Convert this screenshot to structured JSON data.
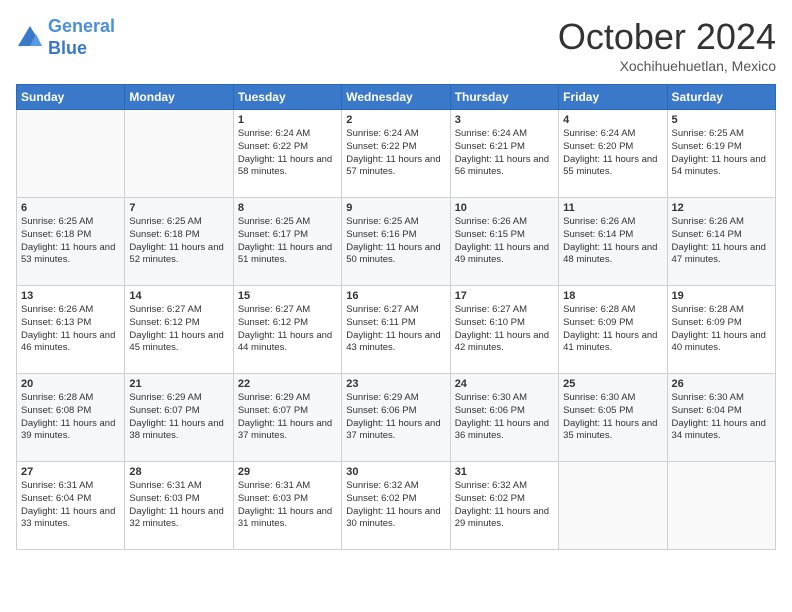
{
  "header": {
    "logo_line1": "General",
    "logo_line2": "Blue",
    "month": "October 2024",
    "location": "Xochihuehuetlan, Mexico"
  },
  "weekdays": [
    "Sunday",
    "Monday",
    "Tuesday",
    "Wednesday",
    "Thursday",
    "Friday",
    "Saturday"
  ],
  "weeks": [
    [
      {
        "day": "",
        "content": ""
      },
      {
        "day": "",
        "content": ""
      },
      {
        "day": "1",
        "content": "Sunrise: 6:24 AM\nSunset: 6:22 PM\nDaylight: 11 hours and 58 minutes."
      },
      {
        "day": "2",
        "content": "Sunrise: 6:24 AM\nSunset: 6:22 PM\nDaylight: 11 hours and 57 minutes."
      },
      {
        "day": "3",
        "content": "Sunrise: 6:24 AM\nSunset: 6:21 PM\nDaylight: 11 hours and 56 minutes."
      },
      {
        "day": "4",
        "content": "Sunrise: 6:24 AM\nSunset: 6:20 PM\nDaylight: 11 hours and 55 minutes."
      },
      {
        "day": "5",
        "content": "Sunrise: 6:25 AM\nSunset: 6:19 PM\nDaylight: 11 hours and 54 minutes."
      }
    ],
    [
      {
        "day": "6",
        "content": "Sunrise: 6:25 AM\nSunset: 6:18 PM\nDaylight: 11 hours and 53 minutes."
      },
      {
        "day": "7",
        "content": "Sunrise: 6:25 AM\nSunset: 6:18 PM\nDaylight: 11 hours and 52 minutes."
      },
      {
        "day": "8",
        "content": "Sunrise: 6:25 AM\nSunset: 6:17 PM\nDaylight: 11 hours and 51 minutes."
      },
      {
        "day": "9",
        "content": "Sunrise: 6:25 AM\nSunset: 6:16 PM\nDaylight: 11 hours and 50 minutes."
      },
      {
        "day": "10",
        "content": "Sunrise: 6:26 AM\nSunset: 6:15 PM\nDaylight: 11 hours and 49 minutes."
      },
      {
        "day": "11",
        "content": "Sunrise: 6:26 AM\nSunset: 6:14 PM\nDaylight: 11 hours and 48 minutes."
      },
      {
        "day": "12",
        "content": "Sunrise: 6:26 AM\nSunset: 6:14 PM\nDaylight: 11 hours and 47 minutes."
      }
    ],
    [
      {
        "day": "13",
        "content": "Sunrise: 6:26 AM\nSunset: 6:13 PM\nDaylight: 11 hours and 46 minutes."
      },
      {
        "day": "14",
        "content": "Sunrise: 6:27 AM\nSunset: 6:12 PM\nDaylight: 11 hours and 45 minutes."
      },
      {
        "day": "15",
        "content": "Sunrise: 6:27 AM\nSunset: 6:12 PM\nDaylight: 11 hours and 44 minutes."
      },
      {
        "day": "16",
        "content": "Sunrise: 6:27 AM\nSunset: 6:11 PM\nDaylight: 11 hours and 43 minutes."
      },
      {
        "day": "17",
        "content": "Sunrise: 6:27 AM\nSunset: 6:10 PM\nDaylight: 11 hours and 42 minutes."
      },
      {
        "day": "18",
        "content": "Sunrise: 6:28 AM\nSunset: 6:09 PM\nDaylight: 11 hours and 41 minutes."
      },
      {
        "day": "19",
        "content": "Sunrise: 6:28 AM\nSunset: 6:09 PM\nDaylight: 11 hours and 40 minutes."
      }
    ],
    [
      {
        "day": "20",
        "content": "Sunrise: 6:28 AM\nSunset: 6:08 PM\nDaylight: 11 hours and 39 minutes."
      },
      {
        "day": "21",
        "content": "Sunrise: 6:29 AM\nSunset: 6:07 PM\nDaylight: 11 hours and 38 minutes."
      },
      {
        "day": "22",
        "content": "Sunrise: 6:29 AM\nSunset: 6:07 PM\nDaylight: 11 hours and 37 minutes."
      },
      {
        "day": "23",
        "content": "Sunrise: 6:29 AM\nSunset: 6:06 PM\nDaylight: 11 hours and 37 minutes."
      },
      {
        "day": "24",
        "content": "Sunrise: 6:30 AM\nSunset: 6:06 PM\nDaylight: 11 hours and 36 minutes."
      },
      {
        "day": "25",
        "content": "Sunrise: 6:30 AM\nSunset: 6:05 PM\nDaylight: 11 hours and 35 minutes."
      },
      {
        "day": "26",
        "content": "Sunrise: 6:30 AM\nSunset: 6:04 PM\nDaylight: 11 hours and 34 minutes."
      }
    ],
    [
      {
        "day": "27",
        "content": "Sunrise: 6:31 AM\nSunset: 6:04 PM\nDaylight: 11 hours and 33 minutes."
      },
      {
        "day": "28",
        "content": "Sunrise: 6:31 AM\nSunset: 6:03 PM\nDaylight: 11 hours and 32 minutes."
      },
      {
        "day": "29",
        "content": "Sunrise: 6:31 AM\nSunset: 6:03 PM\nDaylight: 11 hours and 31 minutes."
      },
      {
        "day": "30",
        "content": "Sunrise: 6:32 AM\nSunset: 6:02 PM\nDaylight: 11 hours and 30 minutes."
      },
      {
        "day": "31",
        "content": "Sunrise: 6:32 AM\nSunset: 6:02 PM\nDaylight: 11 hours and 29 minutes."
      },
      {
        "day": "",
        "content": ""
      },
      {
        "day": "",
        "content": ""
      }
    ]
  ]
}
